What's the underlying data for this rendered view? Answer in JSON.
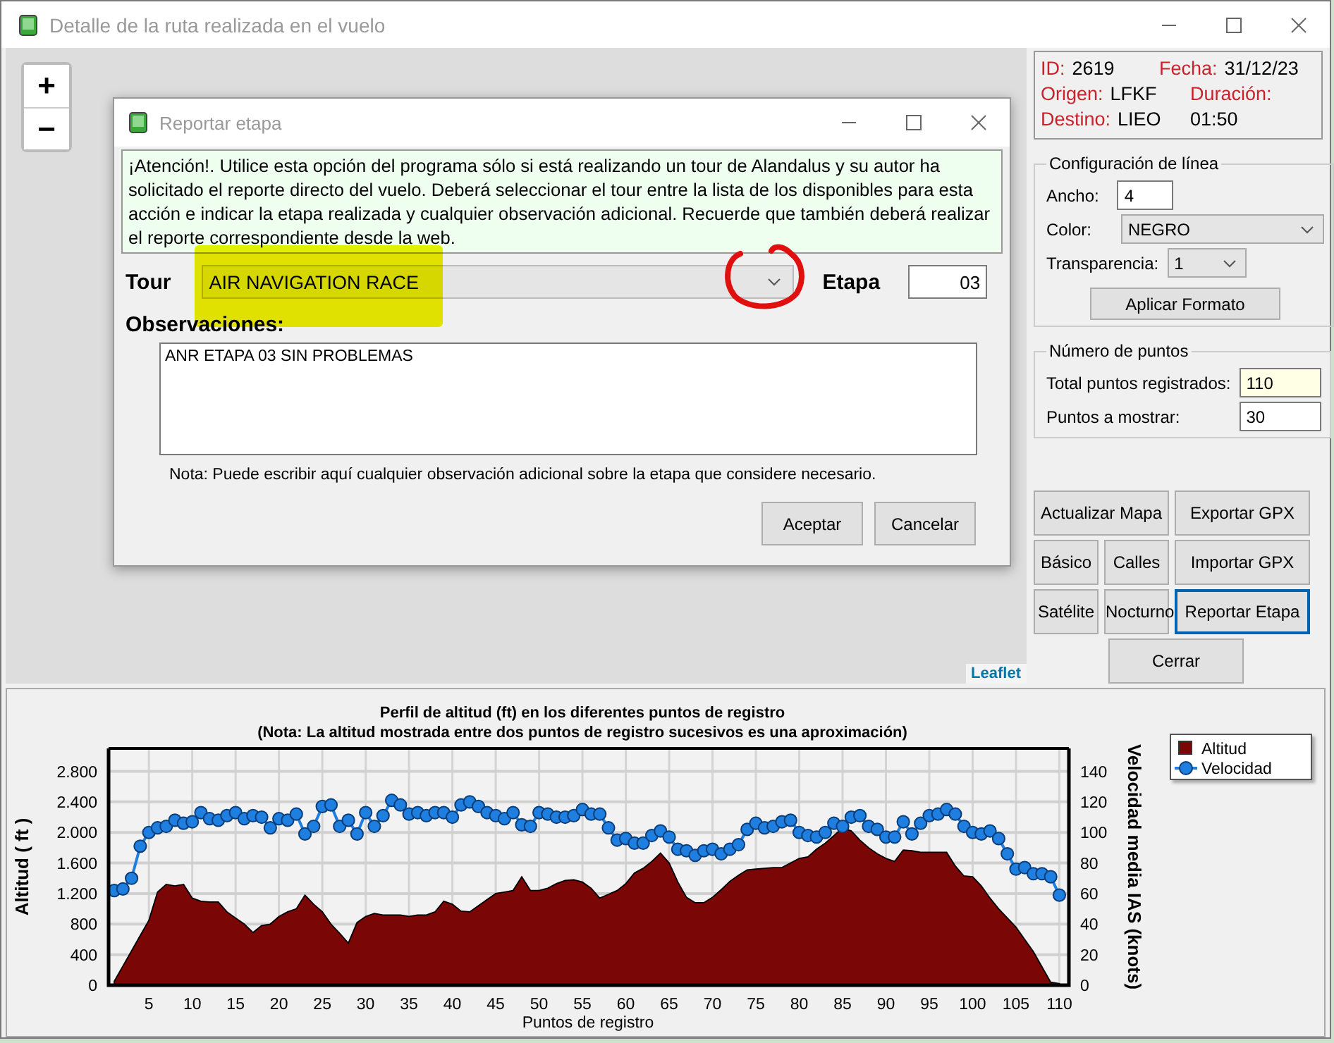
{
  "window": {
    "title": "Detalle de la ruta realizada en el vuelo"
  },
  "map": {
    "zoom_in": "+",
    "zoom_out": "−",
    "attribution": "Leaflet"
  },
  "dialog": {
    "title": "Reportar etapa",
    "notice": "¡Atención!. Utilice esta opción del programa sólo si está realizando un tour de Alandalus y su autor ha solicitado el reporte directo del vuelo. Deberá seleccionar el tour entre la lista de los disponibles para esta acción e indicar la etapa realizada y cualquier observación adicional. Recuerde que también deberá realizar el reporte correspondiente desde la web.",
    "tour_label": "Tour",
    "tour_value": "AIR NAVIGATION RACE",
    "stage_label": "Etapa",
    "stage_value": "03",
    "notes_label": "Observaciones:",
    "notes_value": "ANR ETAPA 03 SIN PROBLEMAS",
    "hint": "Nota: Puede escribir aquí cualquier observación adicional sobre la etapa que considere necesario.",
    "buttons": [
      "Aceptar",
      "Cancelar"
    ]
  },
  "info": [
    [
      {
        "label": "ID:",
        "value": "2619"
      },
      {
        "label": "Fecha:",
        "value": "31/12/23"
      }
    ],
    [
      {
        "label": "Origen:",
        "value": "LFKF"
      },
      {
        "label": "Duración:"
      }
    ],
    [
      {
        "label": "Destino:",
        "value": "LIEO"
      },
      {
        "value": "01:50"
      }
    ]
  ],
  "line_config": {
    "title": "Configuración de línea",
    "width_label": "Ancho:",
    "width_value": "4",
    "color_label": "Color:",
    "color_value": "NEGRO",
    "transparency_label": "Transparencia:",
    "transparency_value": "1",
    "apply_button": "Aplicar Formato"
  },
  "points": {
    "title": "Número de puntos",
    "total_label": "Total puntos registrados:",
    "total_value": "110",
    "show_label": "Puntos a mostrar:",
    "show_value": "30"
  },
  "button_rows": [
    [
      {
        "label": "Actualizar Mapa",
        "focused": false
      },
      {
        "label": "Exportar GPX",
        "focused": false
      }
    ],
    [
      {
        "label": "Básico",
        "focused": false
      },
      {
        "label": "Calles",
        "focused": false
      },
      {
        "label": "Importar GPX",
        "focused": false
      }
    ],
    [
      {
        "label": "Satélite",
        "focused": false
      },
      {
        "label": "Nocturno",
        "focused": false
      },
      {
        "label": "Reportar Etapa",
        "focused": true
      }
    ],
    [
      {
        "label": "Cerrar",
        "focused": false
      }
    ]
  ],
  "chart": {
    "chart_data": {
      "type": "area",
      "title": "Perfil de altitud (ft) en los diferentes puntos de registro",
      "subtitle": "(Nota: La altitud mostrada entre dos puntos de registro sucesivos es una aproximación)",
      "xlabel": "Puntos de registro",
      "ylabel": "Altitud ( ft )",
      "y2label": "Velocidad media IAS (knots)",
      "x": [
        1,
        2,
        3,
        4,
        5,
        6,
        7,
        8,
        9,
        10,
        11,
        12,
        13,
        14,
        15,
        16,
        17,
        18,
        19,
        20,
        21,
        22,
        23,
        24,
        25,
        26,
        27,
        28,
        29,
        30,
        31,
        32,
        33,
        34,
        35,
        36,
        37,
        38,
        39,
        40,
        41,
        42,
        43,
        44,
        45,
        46,
        47,
        48,
        49,
        50,
        51,
        52,
        53,
        54,
        55,
        56,
        57,
        58,
        59,
        60,
        61,
        62,
        63,
        64,
        65,
        66,
        67,
        68,
        69,
        70,
        71,
        72,
        73,
        74,
        75,
        76,
        77,
        78,
        79,
        80,
        81,
        82,
        83,
        84,
        85,
        86,
        87,
        88,
        89,
        90,
        91,
        92,
        93,
        94,
        95,
        96,
        97,
        98,
        99,
        100,
        101,
        102,
        103,
        104,
        105,
        106,
        107,
        108,
        109,
        110
      ],
      "xlim": [
        0.35,
        111.1
      ],
      "grid": true,
      "legend": "right",
      "ylim": [
        0,
        3100
      ],
      "y2lim": [
        0,
        155
      ],
      "xticks": [
        5,
        10,
        15,
        20,
        25,
        30,
        35,
        40,
        45,
        50,
        55,
        60,
        65,
        70,
        75,
        80,
        85,
        90,
        95,
        100,
        105,
        110
      ],
      "yticks": [
        {
          "value": 0,
          "label": "0"
        },
        {
          "value": 400,
          "label": "400"
        },
        {
          "value": 800,
          "label": "800"
        },
        {
          "value": 1200,
          "label": "1.200"
        },
        {
          "value": 1600,
          "label": "1.600"
        },
        {
          "value": 2000,
          "label": "2.000"
        },
        {
          "value": 2400,
          "label": "2.400"
        },
        {
          "value": 2800,
          "label": "2.800"
        }
      ],
      "y2ticks": [
        0,
        20,
        40,
        60,
        80,
        100,
        120,
        140
      ],
      "series": [
        {
          "name": "Altitud",
          "color": "#7a0606",
          "values": [
            50,
            250,
            450,
            650,
            850,
            1220,
            1320,
            1300,
            1320,
            1140,
            1100,
            1090,
            1090,
            960,
            880,
            800,
            690,
            780,
            800,
            900,
            960,
            1000,
            1180,
            1060,
            960,
            800,
            680,
            550,
            820,
            900,
            940,
            920,
            920,
            920,
            900,
            920,
            920,
            960,
            1100,
            1060,
            970,
            960,
            1040,
            1120,
            1200,
            1220,
            1240,
            1420,
            1240,
            1240,
            1270,
            1330,
            1370,
            1380,
            1350,
            1270,
            1140,
            1190,
            1240,
            1330,
            1470,
            1530,
            1620,
            1730,
            1600,
            1350,
            1150,
            1080,
            1080,
            1150,
            1250,
            1360,
            1440,
            1510,
            1520,
            1530,
            1540,
            1540,
            1600,
            1660,
            1680,
            1780,
            1860,
            1960,
            2060,
            2020,
            1900,
            1800,
            1720,
            1660,
            1620,
            1770,
            1760,
            1740,
            1740,
            1740,
            1740,
            1560,
            1430,
            1420,
            1300,
            1140,
            1000,
            880,
            760,
            600,
            440,
            240,
            40,
            20
          ]
        },
        {
          "name": "Velocidad",
          "type": "line",
          "marker": "circle",
          "axis": "y2",
          "color": "#1e7fe0",
          "values": [
            62,
            63,
            70,
            91,
            100,
            103,
            104,
            108,
            106,
            107,
            113,
            109,
            108,
            111,
            113,
            109,
            111,
            110,
            103,
            109,
            108,
            112,
            99,
            104,
            117,
            118,
            104,
            108,
            99,
            113,
            104,
            111,
            121,
            118,
            112,
            113,
            111,
            113,
            113,
            110,
            118,
            120,
            117,
            113,
            111,
            109,
            113,
            105,
            104,
            113,
            112,
            110,
            110,
            111,
            115,
            112,
            112,
            103,
            95,
            96,
            93,
            93,
            98,
            101,
            97,
            89,
            88,
            85,
            88,
            89,
            86,
            89,
            92,
            102,
            106,
            103,
            104,
            107,
            108,
            100,
            98,
            97,
            100,
            106,
            104,
            110,
            111,
            104,
            102,
            97,
            97,
            107,
            99,
            106,
            111,
            112,
            115,
            112,
            104,
            100,
            99,
            101,
            96,
            86,
            76,
            77,
            73,
            73,
            71,
            59
          ]
        }
      ]
    }
  }
}
